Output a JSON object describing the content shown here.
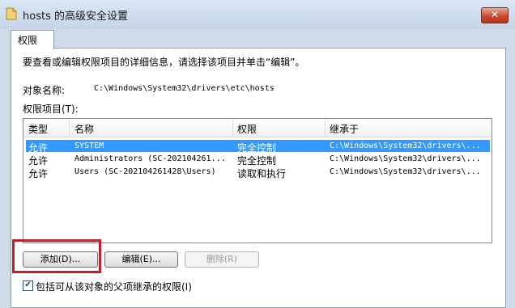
{
  "window": {
    "title": "hosts 的高级安全设置",
    "close_symbol": "✕"
  },
  "tab": {
    "label": "权限"
  },
  "instruction": "要查看或编辑权限项目的详细信息，请选择该项目并单击“编辑”。",
  "object": {
    "label": "对象名称:",
    "value": "C:\\Windows\\System32\\drivers\\etc\\hosts"
  },
  "entries_label": "权限项目(T):",
  "columns": [
    "类型",
    "名称",
    "权限",
    "继承于"
  ],
  "rows": [
    {
      "type": "允许",
      "name": "SYSTEM",
      "permission": "完全控制",
      "inherited": "C:\\Windows\\System32\\drivers\\...",
      "selected": true
    },
    {
      "type": "允许",
      "name": "Administrators (SC-202104261...",
      "permission": "完全控制",
      "inherited": "C:\\Windows\\System32\\drivers\\...",
      "selected": false
    },
    {
      "type": "允许",
      "name": "Users (SC-202104261428\\Users)",
      "permission": "读取和执行",
      "inherited": "C:\\Windows\\System32\\drivers\\...",
      "selected": false
    }
  ],
  "buttons": {
    "add": "添加(D)...",
    "edit": "编辑(E)...",
    "remove": "删除(R)"
  },
  "checkbox": {
    "label": "包括可从该对象的父项继承的权限(I)",
    "checked": true,
    "mark": "✔"
  },
  "colors": {
    "selection": "#3399ff",
    "highlight_box": "#c0202a",
    "close_button": "#c84a30"
  }
}
